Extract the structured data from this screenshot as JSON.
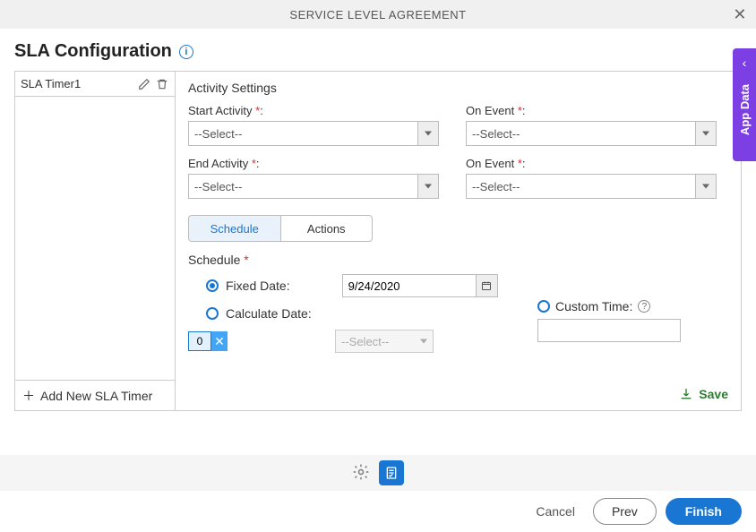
{
  "header": {
    "title": "SERVICE LEVEL AGREEMENT"
  },
  "page": {
    "title": "SLA Configuration"
  },
  "sidebar": {
    "timers": [
      {
        "name": "SLA Timer1"
      }
    ],
    "add_label": "Add New SLA Timer"
  },
  "activity": {
    "heading": "Activity Settings",
    "start_label": "Start Activity",
    "end_label": "End Activity",
    "on_event_label": "On Event",
    "select_placeholder": "--Select--"
  },
  "tabs": {
    "schedule": "Schedule",
    "actions": "Actions"
  },
  "schedule": {
    "label": "Schedule",
    "fixed_date_label": "Fixed Date:",
    "calculate_date_label": "Calculate Date:",
    "custom_time_label": "Custom Time:",
    "date_value": "9/24/2020",
    "num_value": "0",
    "calc_select_placeholder": "--Select--"
  },
  "buttons": {
    "save": "Save",
    "cancel": "Cancel",
    "prev": "Prev",
    "finish": "Finish"
  },
  "side_panel": {
    "label": "App Data"
  }
}
